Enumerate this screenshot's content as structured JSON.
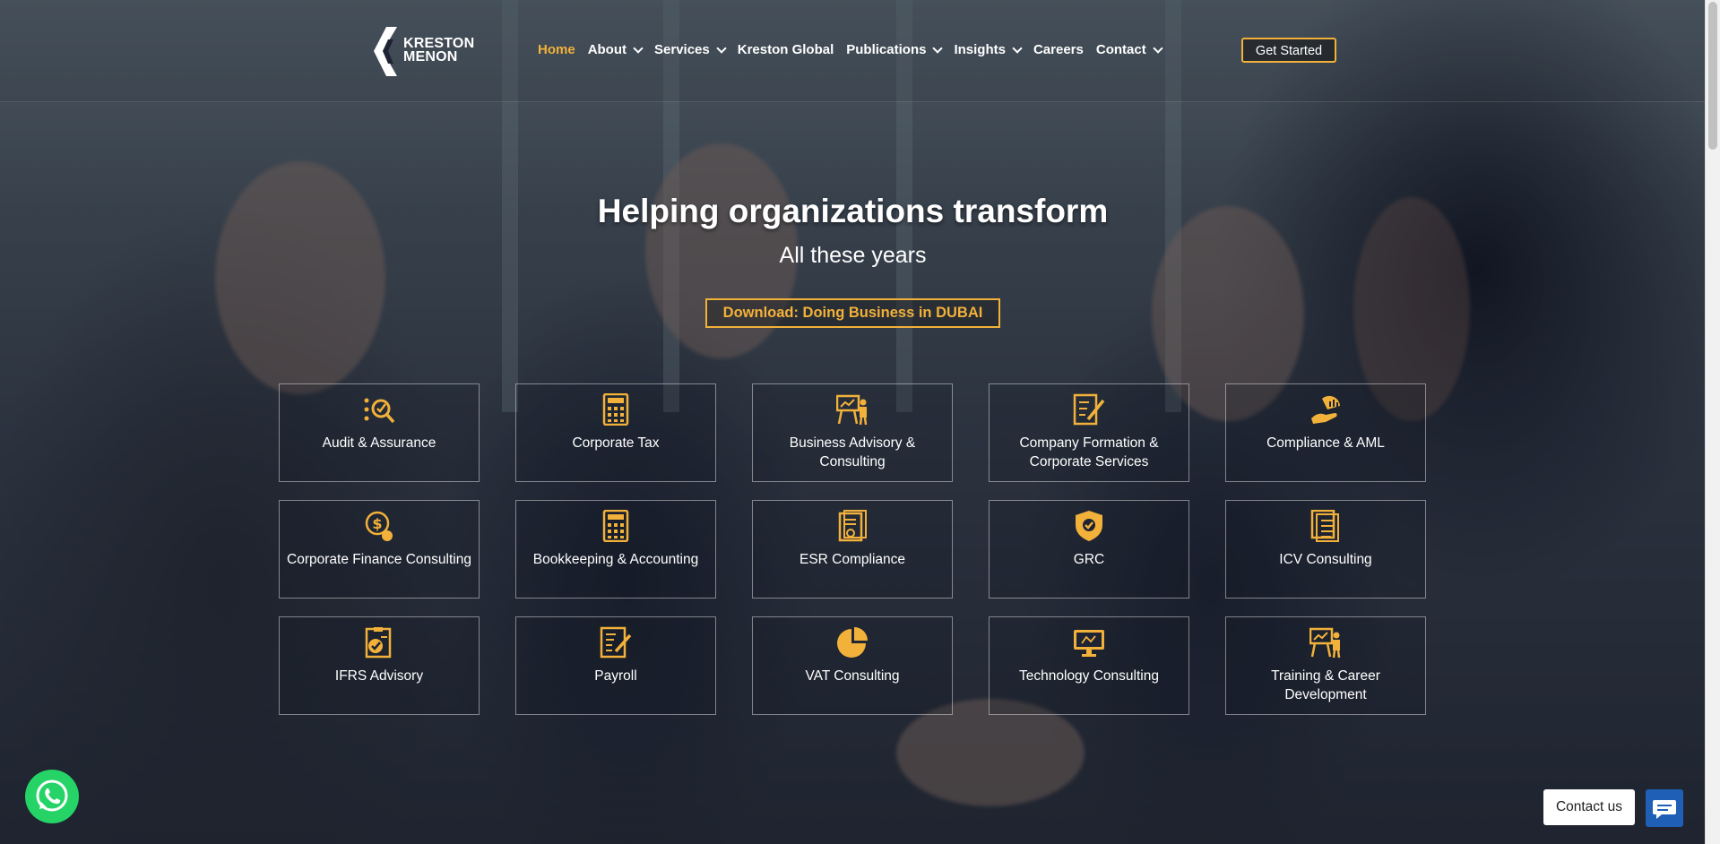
{
  "brand": {
    "line1": "KRESTON",
    "line2": "MENON",
    "accent_color": "#f2b13a"
  },
  "nav": {
    "items": [
      {
        "label": "Home",
        "has_dropdown": false,
        "active": true
      },
      {
        "label": "About",
        "has_dropdown": true
      },
      {
        "label": "Services",
        "has_dropdown": true
      },
      {
        "label": "Kreston Global",
        "has_dropdown": false
      },
      {
        "label": "Publications",
        "has_dropdown": true
      },
      {
        "label": "Insights",
        "has_dropdown": true
      },
      {
        "label": "Careers",
        "has_dropdown": false
      },
      {
        "label": "Contact",
        "has_dropdown": true
      }
    ],
    "cta": "Get Started"
  },
  "hero": {
    "title": "Helping organizations transform",
    "subtitle": "All these years",
    "download_label": "Download: Doing Business in DUBAI"
  },
  "services": [
    {
      "label": "Audit & Assurance",
      "icon": "audit-icon"
    },
    {
      "label": "Corporate Tax",
      "icon": "calculator-icon"
    },
    {
      "label": "Business Advisory & Consulting",
      "icon": "presentation-icon"
    },
    {
      "label": "Company Formation & Corporate Services",
      "icon": "document-edit-icon"
    },
    {
      "label": "Compliance & AML",
      "icon": "hand-chart-icon"
    },
    {
      "label": "Corporate Finance Consulting",
      "icon": "dollar-hand-icon"
    },
    {
      "label": "Bookkeeping & Accounting",
      "icon": "calculator-icon"
    },
    {
      "label": "ESR Compliance",
      "icon": "certificate-icon"
    },
    {
      "label": "GRC",
      "icon": "shield-check-icon"
    },
    {
      "label": "ICV Consulting",
      "icon": "checklist-icon"
    },
    {
      "label": "IFRS Advisory",
      "icon": "checklist-pen-icon"
    },
    {
      "label": "Payroll",
      "icon": "document-pen-icon"
    },
    {
      "label": "VAT Consulting",
      "icon": "pie-chart-icon"
    },
    {
      "label": "Technology Consulting",
      "icon": "monitor-icon"
    },
    {
      "label": "Training & Career Development",
      "icon": "presentation-icon"
    }
  ],
  "widgets": {
    "contact_label": "Contact us",
    "whatsapp_color": "#25d366",
    "chat_color": "#1f5fb5"
  }
}
